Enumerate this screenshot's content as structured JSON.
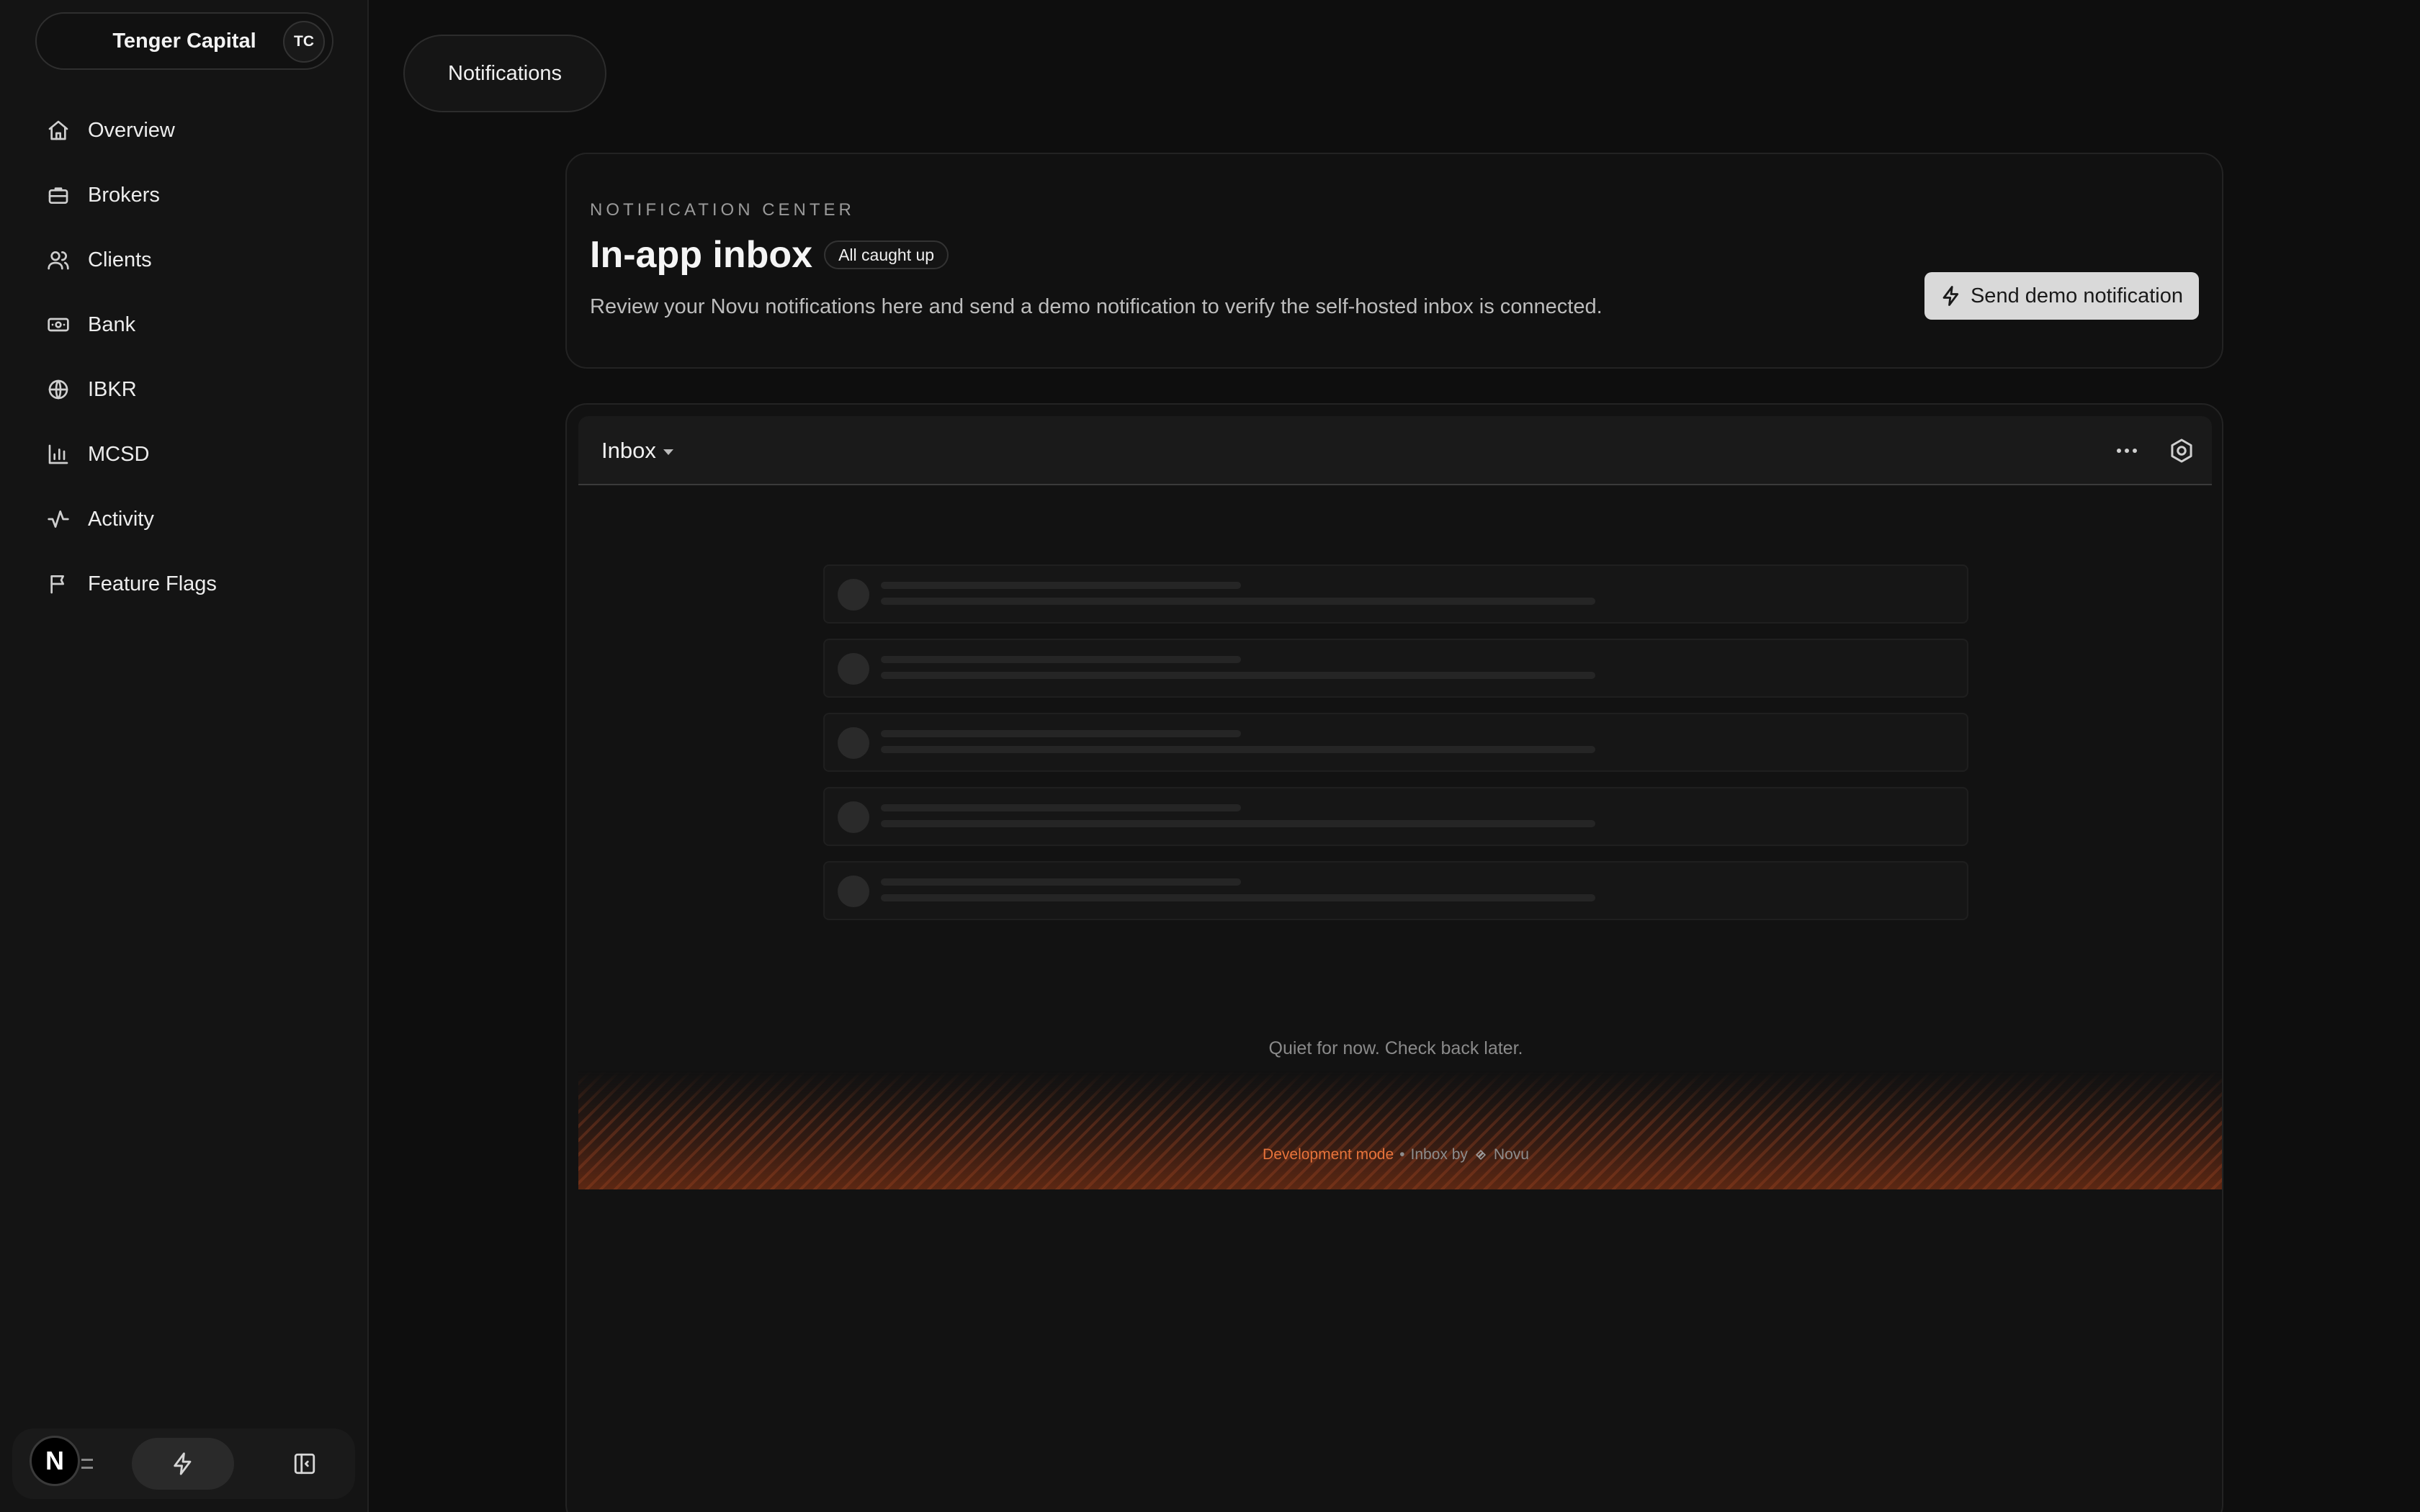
{
  "sidebar": {
    "org_name": "Tenger Capital",
    "org_initials": "TC",
    "items": [
      {
        "label": "Overview",
        "icon": "home-icon"
      },
      {
        "label": "Brokers",
        "icon": "briefcase-icon"
      },
      {
        "label": "Clients",
        "icon": "users-icon"
      },
      {
        "label": "Bank",
        "icon": "banknote-icon"
      },
      {
        "label": "IBKR",
        "icon": "globe-icon"
      },
      {
        "label": "MCSD",
        "icon": "bar-chart-icon"
      },
      {
        "label": "Activity",
        "icon": "activity-icon"
      },
      {
        "label": "Feature Flags",
        "icon": "flag-icon"
      }
    ],
    "bottom": {
      "badge_letter": "N"
    }
  },
  "page": {
    "tab_label": "Notifications"
  },
  "header_card": {
    "eyebrow": "NOTIFICATION CENTER",
    "title": "In-app inbox",
    "badge": "All caught up",
    "description": "Review your Novu notifications here and send a demo notification to verify the self-hosted inbox is connected.",
    "button_label": "Send demo notification"
  },
  "inbox": {
    "title": "Inbox",
    "empty_text": "Quiet for now. Check back later.",
    "footer": {
      "dev_mode": "Development mode",
      "separator": "•",
      "inbox_by": "Inbox by",
      "brand": "Novu"
    },
    "skeleton_rows": 5
  },
  "colors": {
    "background": "#0e0e0e",
    "sidebar": "#141414",
    "accent_orange": "#e8743b",
    "button_bg": "#d9d9d9"
  }
}
